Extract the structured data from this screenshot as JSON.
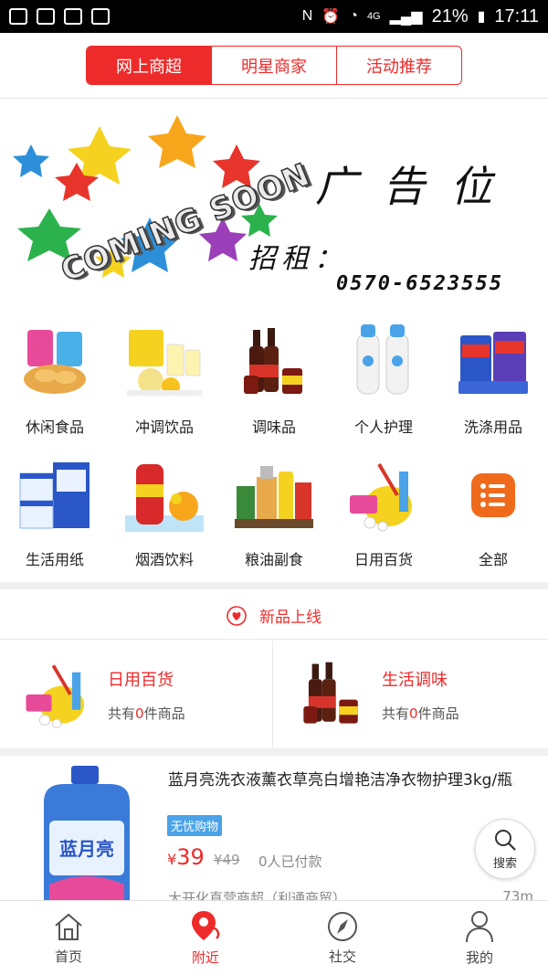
{
  "status_bar": {
    "battery": "21%",
    "time": "17:11",
    "network": "4G"
  },
  "tabs": [
    {
      "label": "网上商超",
      "active": true
    },
    {
      "label": "明星商家",
      "active": false
    },
    {
      "label": "活动推荐",
      "active": false
    }
  ],
  "banner": {
    "coming_soon": "COMING SOON",
    "title": "广告位",
    "rent": "招租：",
    "phone": "0570-6523555"
  },
  "categories": [
    {
      "label": "休闲食品",
      "icon": "snacks-image"
    },
    {
      "label": "冲调饮品",
      "icon": "drinks-image"
    },
    {
      "label": "调味品",
      "icon": "seasoning-image"
    },
    {
      "label": "个人护理",
      "icon": "personal-care-image"
    },
    {
      "label": "洗涤用品",
      "icon": "detergent-image"
    },
    {
      "label": "生活用纸",
      "icon": "tissue-image"
    },
    {
      "label": "烟酒饮料",
      "icon": "beverage-image"
    },
    {
      "label": "粮油副食",
      "icon": "grain-oil-image"
    },
    {
      "label": "日用百货",
      "icon": "daily-goods-image"
    },
    {
      "label": "全部",
      "icon": "list-icon"
    }
  ],
  "new_items": {
    "label": "新品上线"
  },
  "promos": [
    {
      "title": "日用百货",
      "prefix": "共有",
      "count": "0",
      "suffix": "件商品"
    },
    {
      "title": "生活调味",
      "prefix": "共有",
      "count": "0",
      "suffix": "件商品"
    }
  ],
  "product": {
    "title": "蓝月亮洗衣液薰衣草亮白增艳洁净衣物护理3kg/瓶",
    "tag": "无忧购物",
    "currency": "¥",
    "price": "39",
    "old_price": "¥49",
    "paid": "0人已付款",
    "store": "大开化直营商超（利通商贸）",
    "distance": "73m",
    "brand_text": "蓝月亮"
  },
  "float_search": {
    "label": "搜索"
  },
  "bottom_nav": [
    {
      "label": "首页",
      "icon": "home-icon",
      "active": false
    },
    {
      "label": "附近",
      "icon": "location-pin-icon",
      "active": true
    },
    {
      "label": "社交",
      "icon": "compass-icon",
      "active": false
    },
    {
      "label": "我的",
      "icon": "user-icon",
      "active": false
    }
  ],
  "colors": {
    "accent": "#ee2b2b",
    "tag_blue": "#4aa3e8"
  }
}
